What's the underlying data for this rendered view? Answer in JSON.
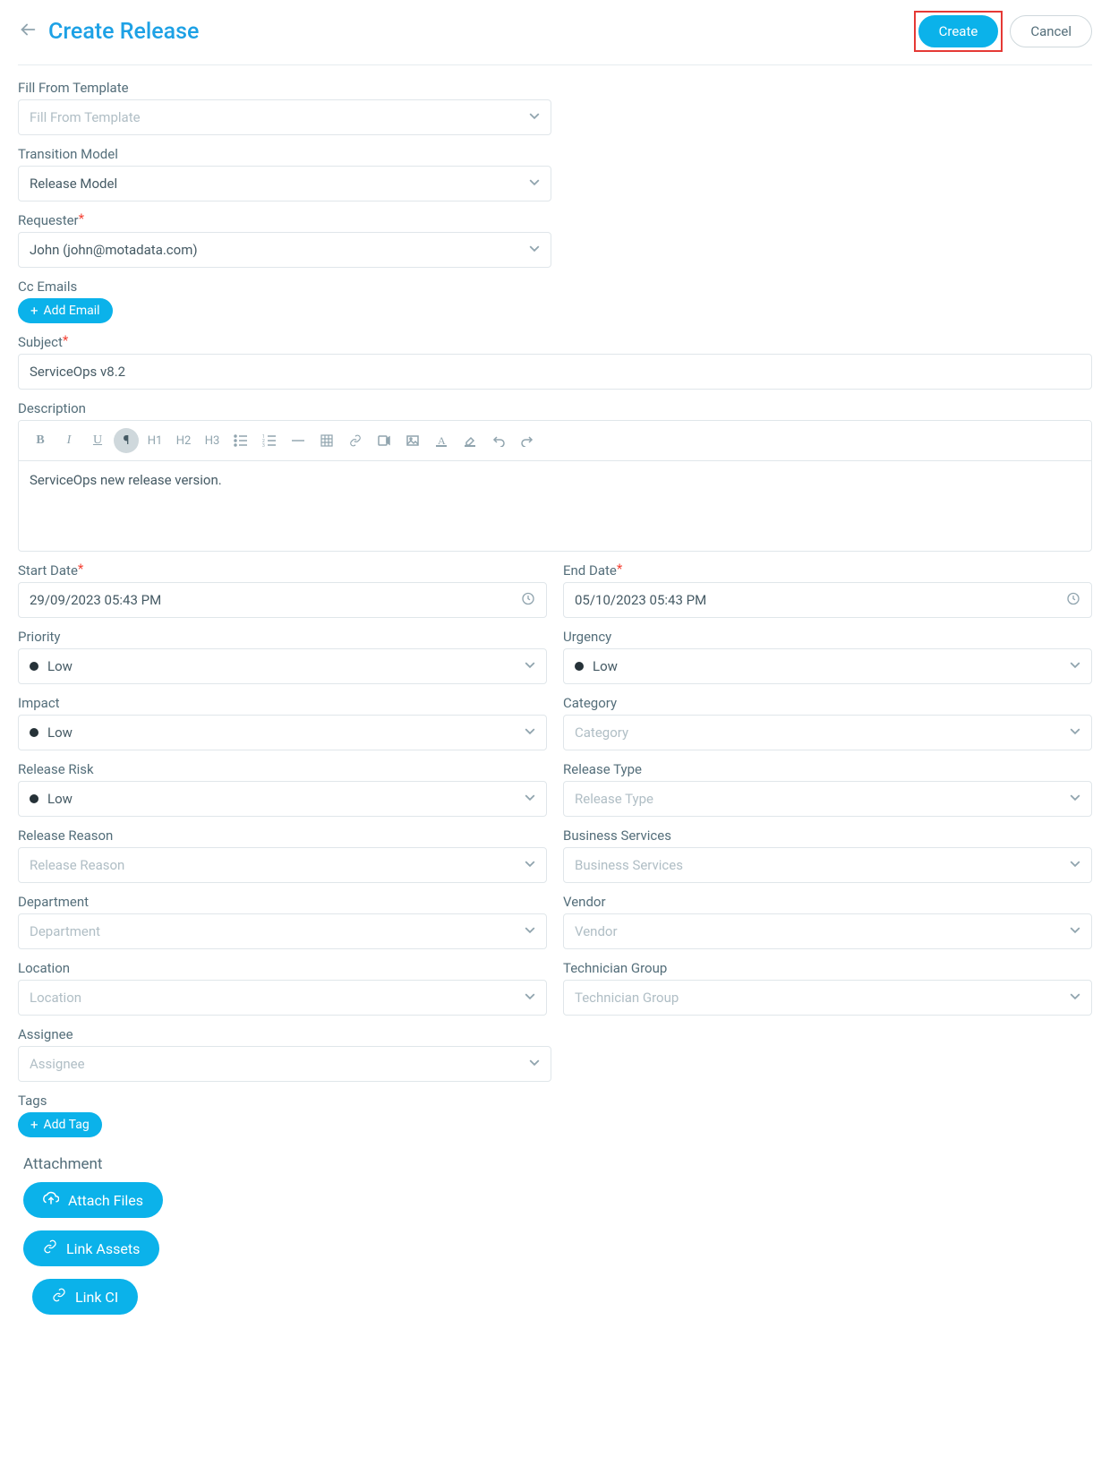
{
  "header": {
    "title": "Create Release",
    "create_label": "Create",
    "cancel_label": "Cancel"
  },
  "labels": {
    "fill_from_template": "Fill From Template",
    "transition_model": "Transition Model",
    "requester": "Requester",
    "cc_emails": "Cc Emails",
    "subject": "Subject",
    "description": "Description",
    "start_date": "Start Date",
    "end_date": "End Date",
    "priority": "Priority",
    "urgency": "Urgency",
    "impact": "Impact",
    "category": "Category",
    "release_risk": "Release Risk",
    "release_type": "Release Type",
    "release_reason": "Release Reason",
    "business_services": "Business Services",
    "department": "Department",
    "vendor": "Vendor",
    "location": "Location",
    "technician_group": "Technician Group",
    "assignee": "Assignee",
    "tags": "Tags",
    "attachment": "Attachment"
  },
  "placeholders": {
    "fill_from_template": "Fill From Template",
    "category": "Category",
    "release_type": "Release Type",
    "release_reason": "Release Reason",
    "business_services": "Business Services",
    "department": "Department",
    "vendor": "Vendor",
    "location": "Location",
    "technician_group": "Technician Group",
    "assignee": "Assignee"
  },
  "values": {
    "transition_model": "Release Model",
    "requester": "John (john@motadata.com)",
    "subject": "ServiceOps v8.2",
    "description": "ServiceOps new release version.",
    "start_date": "29/09/2023 05:43 PM",
    "end_date": "05/10/2023 05:43 PM",
    "priority": "Low",
    "urgency": "Low",
    "impact": "Low",
    "release_risk": "Low"
  },
  "buttons": {
    "add_email": "Add Email",
    "add_tag": "Add Tag",
    "attach_files": "Attach Files",
    "link_assets": "Link Assets",
    "link_ci": "Link CI"
  },
  "toolbar": {
    "h1": "H1",
    "h2": "H2",
    "h3": "H3"
  }
}
